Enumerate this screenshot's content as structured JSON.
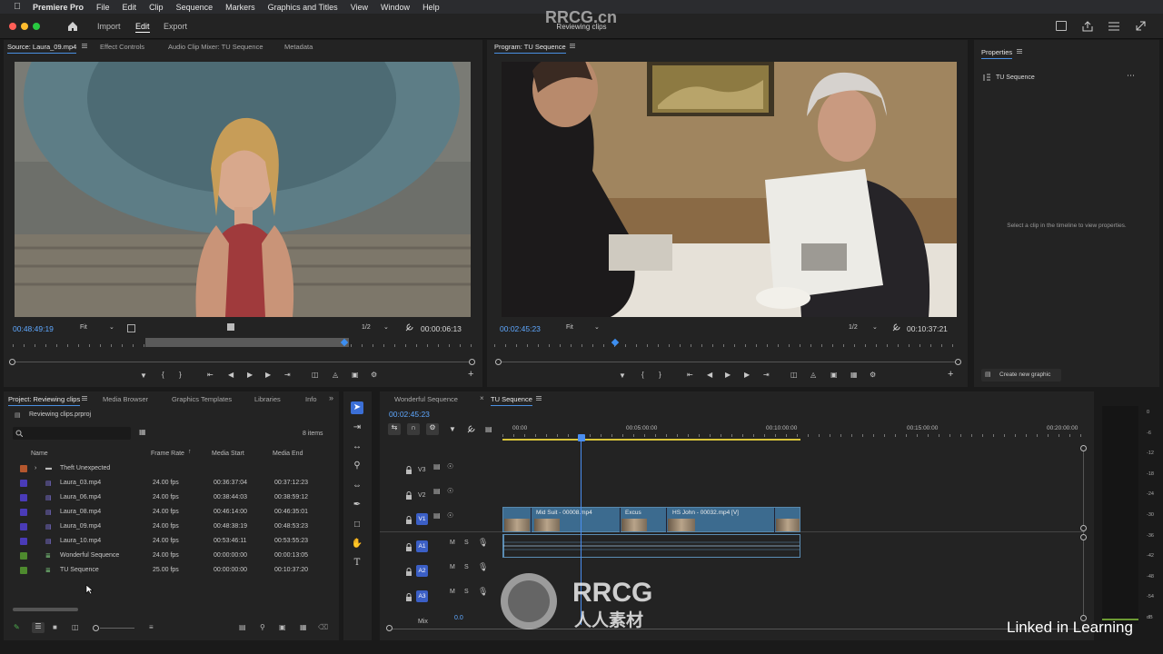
{
  "menubar": {
    "app_name": "Premiere Pro",
    "items": [
      "File",
      "Edit",
      "Clip",
      "Sequence",
      "Markers",
      "Graphics and Titles",
      "View",
      "Window",
      "Help"
    ]
  },
  "header": {
    "workspaces": [
      "Import",
      "Edit",
      "Export"
    ],
    "active_workspace": "Edit",
    "project_title": "Reviewing clips"
  },
  "source_monitor": {
    "tabs": [
      "Source: Laura_09.mp4",
      "Effect Controls",
      "Audio Clip Mixer: TU Sequence",
      "Metadata"
    ],
    "timecode": "00:48:49:19",
    "zoom": "Fit",
    "resolution": "1/2",
    "duration": "00:00:06:13"
  },
  "program_monitor": {
    "tab": "Program: TU Sequence",
    "timecode": "00:02:45:23",
    "zoom": "Fit",
    "resolution": "1/2",
    "duration": "00:10:37:21"
  },
  "properties": {
    "tab": "Properties",
    "sequence_name": "TU Sequence",
    "empty_message": "Select a clip in the timeline to view properties.",
    "create_graphic_label": "Create new graphic"
  },
  "project": {
    "tabs": [
      "Project: Reviewing clips",
      "Media Browser",
      "Graphics Templates",
      "Libraries",
      "Info"
    ],
    "file": "Reviewing clips.prproj",
    "search_placeholder": "",
    "item_count": "8 items",
    "columns": [
      "Name",
      "Frame Rate",
      "Media Start",
      "Media End"
    ],
    "rows": [
      {
        "name": "Theft Unexpected",
        "color": "#b4572e",
        "type": "bin",
        "fps": "",
        "start": "",
        "end": ""
      },
      {
        "name": "Laura_03.mp4",
        "color": "#4a3bb8",
        "type": "clip",
        "fps": "24.00 fps",
        "start": "00:36:37:04",
        "end": "00:37:12:23"
      },
      {
        "name": "Laura_06.mp4",
        "color": "#4a3bb8",
        "type": "clip",
        "fps": "24.00 fps",
        "start": "00:38:44:03",
        "end": "00:38:59:12"
      },
      {
        "name": "Laura_08.mp4",
        "color": "#4a3bb8",
        "type": "clip",
        "fps": "24.00 fps",
        "start": "00:46:14:00",
        "end": "00:46:35:01"
      },
      {
        "name": "Laura_09.mp4",
        "color": "#4a3bb8",
        "type": "clip",
        "fps": "24.00 fps",
        "start": "00:48:38:19",
        "end": "00:48:53:23"
      },
      {
        "name": "Laura_10.mp4",
        "color": "#4a3bb8",
        "type": "clip",
        "fps": "24.00 fps",
        "start": "00:53:46:11",
        "end": "00:53:55:23"
      },
      {
        "name": "Wonderful Sequence",
        "color": "#4e8a2e",
        "type": "sequence",
        "fps": "24.00 fps",
        "start": "00:00:00:00",
        "end": "00:00:13:05"
      },
      {
        "name": "TU Sequence",
        "color": "#4e8a2e",
        "type": "sequence",
        "fps": "25.00 fps",
        "start": "00:00:00:00",
        "end": "00:10:37:20"
      }
    ]
  },
  "timeline": {
    "tabs": [
      "Wonderful Sequence",
      "TU Sequence"
    ],
    "active_tab": "TU Sequence",
    "timecode": "00:02:45:23",
    "ruler_labels": [
      "00:00",
      "00:05:00:00",
      "00:10:00:00",
      "00:15:00:00",
      "00:20:00:00"
    ],
    "video_tracks": [
      "V3",
      "V2",
      "V1"
    ],
    "audio_tracks": [
      "A1",
      "A2",
      "A3"
    ],
    "mix_label": "Mix",
    "mix_value": "0.0",
    "clips": [
      "Mid Suit - 00008.mp4",
      "Excus",
      "HS John - 00032.mp4 [V]"
    ]
  },
  "meter_ticks": [
    "0",
    "-6",
    "-12",
    "-18",
    "-24",
    "-30",
    "-36",
    "-42",
    "-48",
    "-54",
    "dB"
  ],
  "watermarks": {
    "rrcg_top": "RRCG.cn",
    "rrcg_logo": "RRCG",
    "rrcg_sub": "人人素材",
    "linkedin": "Linked in Learning"
  },
  "colors": {
    "accent": "#4a90e2",
    "timecode": "#5fa8ff",
    "clip_video": "#3c6b8f",
    "clip_audio": "#3b6c92",
    "label_violet": "#4a3bb8",
    "label_green": "#4e8a2e"
  }
}
